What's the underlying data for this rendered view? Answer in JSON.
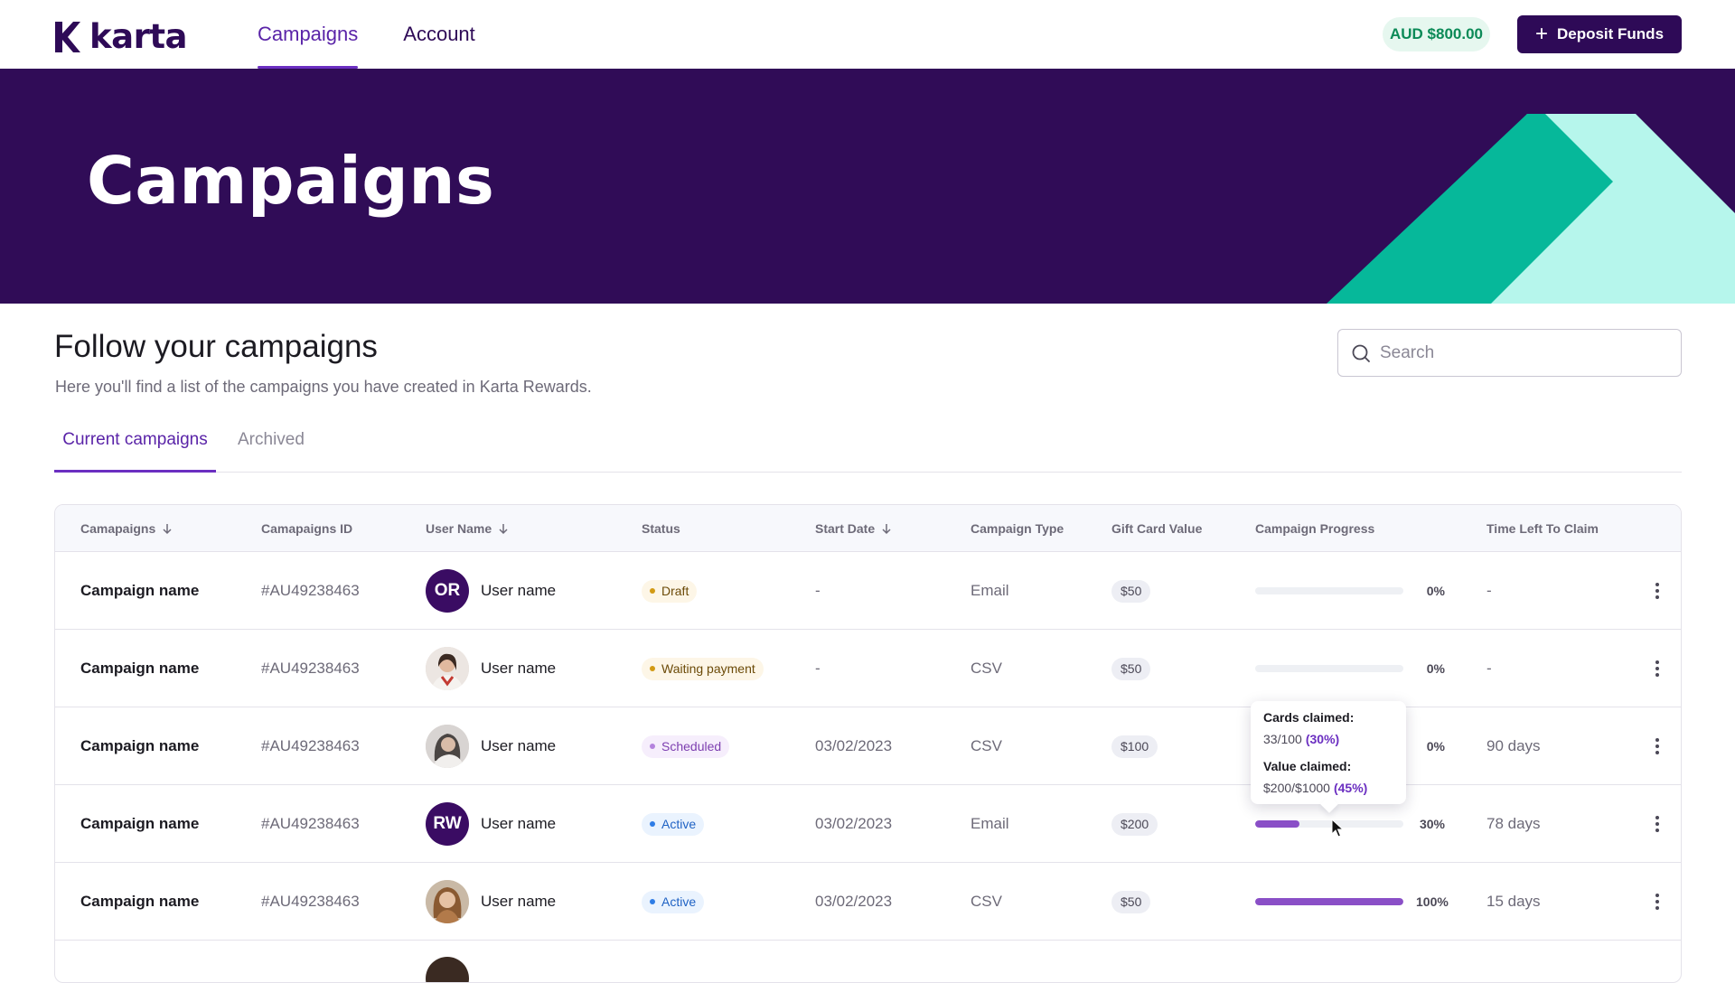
{
  "nav": {
    "logo_text": "karta",
    "items": [
      {
        "label": "Campaigns",
        "active": true
      },
      {
        "label": "Account",
        "active": false
      }
    ],
    "balance": "AUD $800.00",
    "deposit_label": "Deposit Funds"
  },
  "hero": {
    "title": "Campaigns"
  },
  "section": {
    "title": "Follow your campaigns",
    "subtitle": "Here you'll find a list of the campaigns you have created in Karta Rewards."
  },
  "search": {
    "placeholder": "Search",
    "value": ""
  },
  "tabs": [
    {
      "label": "Current campaigns",
      "active": true
    },
    {
      "label": "Archived",
      "active": false
    }
  ],
  "table": {
    "headers": [
      {
        "label": "Camapaigns",
        "sortable": true
      },
      {
        "label": "Camapaigns ID",
        "sortable": false
      },
      {
        "label": "User Name",
        "sortable": true
      },
      {
        "label": "Status",
        "sortable": false
      },
      {
        "label": "Start Date",
        "sortable": true
      },
      {
        "label": "Campaign Type",
        "sortable": false
      },
      {
        "label": "Gift Card Value",
        "sortable": false
      },
      {
        "label": "Campaign Progress",
        "sortable": false
      },
      {
        "label": "Time Left To Claim",
        "sortable": false
      }
    ],
    "rows": [
      {
        "name": "Campaign name",
        "id": "#AU49238463",
        "avatar": "OR",
        "user": "User name",
        "status": "Draft",
        "start": "-",
        "type": "Email",
        "value": "$50",
        "progress": 0,
        "progress_label": "0%",
        "time_left": "-"
      },
      {
        "name": "Campaign name",
        "id": "#AU49238463",
        "avatar": "",
        "user": "User name",
        "status": "Waiting payment",
        "start": "-",
        "type": "CSV",
        "value": "$50",
        "progress": 0,
        "progress_label": "0%",
        "time_left": "-"
      },
      {
        "name": "Campaign name",
        "id": "#AU49238463",
        "avatar": "",
        "user": "User name",
        "status": "Scheduled",
        "start": "03/02/2023",
        "type": "CSV",
        "value": "$100",
        "progress": 0,
        "progress_label": "0%",
        "time_left": "90 days"
      },
      {
        "name": "Campaign name",
        "id": "#AU49238463",
        "avatar": "RW",
        "user": "User name",
        "status": "Active",
        "start": "03/02/2023",
        "type": "Email",
        "value": "$200",
        "progress": 0.3,
        "progress_label": "30%",
        "time_left": "78 days"
      },
      {
        "name": "Campaign name",
        "id": "#AU49238463",
        "avatar": "",
        "user": "User name",
        "status": "Active",
        "start": "03/02/2023",
        "type": "CSV",
        "value": "$50",
        "progress": 1.0,
        "progress_label": "100%",
        "time_left": "15 days"
      }
    ]
  },
  "tooltip": {
    "cards_label": "Cards claimed:",
    "cards_value": "33/100",
    "cards_pct": "(30%)",
    "value_label": "Value claimed:",
    "value_value": "$200/$1000",
    "value_pct": "(45%)"
  },
  "colors": {
    "brand": "#2e0a57",
    "accent": "#6b2fc1",
    "hero_bg": "#300c57",
    "teal": "#06b89a",
    "mint": "#b6f6ec",
    "balance_text": "#0b8a57"
  }
}
